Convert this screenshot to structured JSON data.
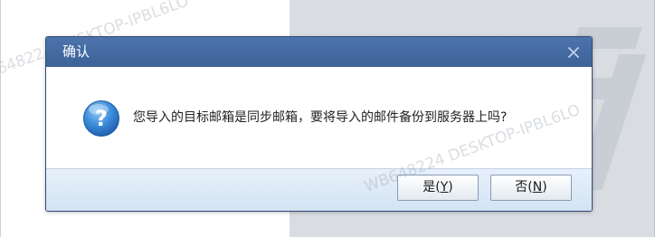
{
  "dialog": {
    "title": "确认",
    "message": "您导入的目标邮箱是同步邮箱，要将导入的邮件备份到服务器上吗?",
    "icon": "question-icon",
    "buttons": {
      "yes": {
        "label": "是",
        "paren_open": "(",
        "mnemonic": "Y",
        "paren_close": ")"
      },
      "no": {
        "label": "否",
        "paren_open": "(",
        "mnemonic": "N",
        "paren_close": ")"
      }
    }
  },
  "watermarks": [
    "648224 DESKTOP-IPBL6LO",
    "WB648224 DESKTOP-IPBL6LO"
  ],
  "colors": {
    "titlebar": "#4469a2",
    "footer": "#dbe7f5",
    "icon": "#3b8ad8"
  }
}
